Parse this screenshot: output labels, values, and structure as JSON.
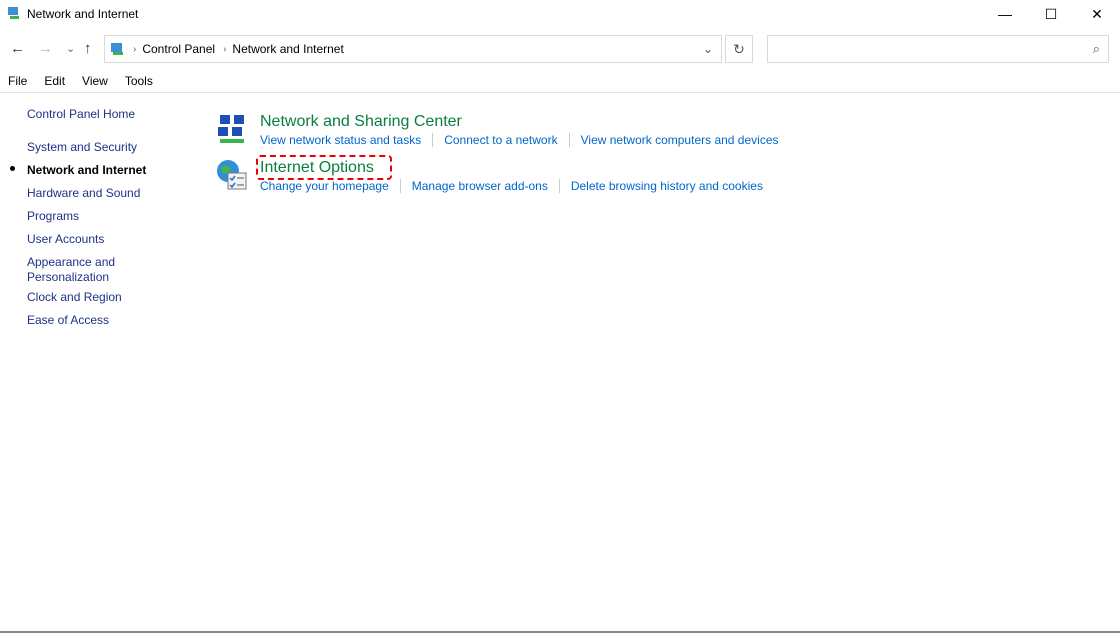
{
  "window": {
    "title": "Network and Internet",
    "minimize": "—",
    "maximize": "☐",
    "close": "✕"
  },
  "nav": {
    "back": "←",
    "forward": "→",
    "recent": "⌄",
    "up": "↑"
  },
  "address": {
    "crumbs": [
      "Control Panel",
      "Network and Internet"
    ],
    "sep": "›",
    "dropdown": "⌄",
    "refresh": "↻"
  },
  "search": {
    "placeholder": "",
    "icon": "⌕"
  },
  "menu": [
    "File",
    "Edit",
    "View",
    "Tools"
  ],
  "sidebar": {
    "home": "Control Panel Home",
    "items": [
      "System and Security",
      "Network and Internet",
      "Hardware and Sound",
      "Programs",
      "User Accounts",
      "Appearance and Personalization",
      "Clock and Region",
      "Ease of Access"
    ]
  },
  "categories": [
    {
      "title": "Network and Sharing Center",
      "links": [
        "View network status and tasks",
        "Connect to a network",
        "View network computers and devices"
      ]
    },
    {
      "title": "Internet Options",
      "links": [
        "Change your homepage",
        "Manage browser add-ons",
        "Delete browsing history and cookies"
      ]
    }
  ],
  "colors": {
    "link": "#0066cc",
    "category": "#0a7f3d",
    "highlight": "#e00000"
  }
}
